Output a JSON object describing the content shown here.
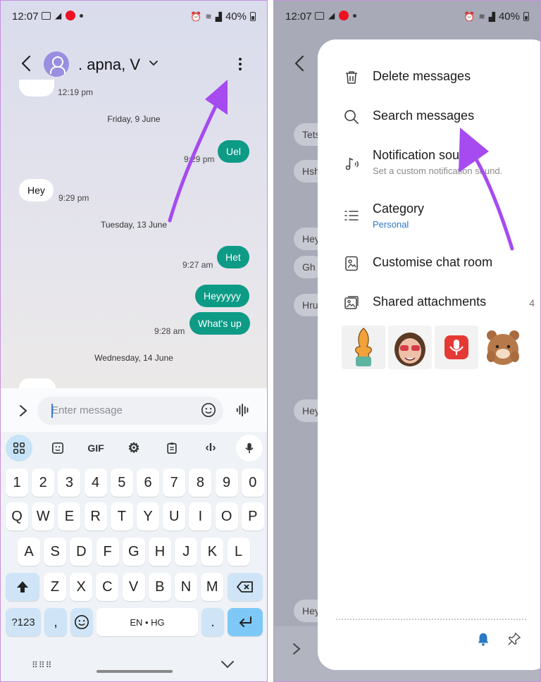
{
  "status": {
    "time": "12:07",
    "battery": "40%"
  },
  "left": {
    "contact_name": ". apna, V",
    "messages": [
      {
        "kind": "ts",
        "text": "12:19 pm"
      },
      {
        "kind": "day",
        "text": "Friday, 9 June"
      },
      {
        "kind": "out",
        "text": "Uel"
      },
      {
        "kind": "ts",
        "text": "9:29 pm"
      },
      {
        "kind": "in",
        "text": "Hey"
      },
      {
        "kind": "ts",
        "text": "9:29 pm"
      },
      {
        "kind": "day",
        "text": "Tuesday, 13 June"
      },
      {
        "kind": "out",
        "text": "Het"
      },
      {
        "kind": "ts",
        "text": "9:27 am"
      },
      {
        "kind": "out",
        "text": "Heyyyyy"
      },
      {
        "kind": "out",
        "text": "What's up"
      },
      {
        "kind": "ts",
        "text": "9:28 am"
      },
      {
        "kind": "day",
        "text": "Wednesday, 14 June"
      }
    ],
    "composer_placeholder": "Enter message",
    "keyboard": {
      "tools": [
        "GIF"
      ],
      "row_numbers": [
        "1",
        "2",
        "3",
        "4",
        "5",
        "6",
        "7",
        "8",
        "9",
        "0"
      ],
      "row_q": [
        "Q",
        "W",
        "E",
        "R",
        "T",
        "Y",
        "U",
        "I",
        "O",
        "P"
      ],
      "row_a": [
        "A",
        "S",
        "D",
        "F",
        "G",
        "H",
        "J",
        "K",
        "L"
      ],
      "row_z": [
        "Z",
        "X",
        "C",
        "V",
        "B",
        "N",
        "M"
      ],
      "symbols_key": "?123",
      "comma_key": ",",
      "space_key": "EN • HG",
      "period_key": "."
    }
  },
  "right": {
    "background_snippets": [
      "Tets",
      "Hsh",
      "Hey",
      "Gh",
      "Hru",
      "Hey",
      "Hey"
    ],
    "menu": [
      {
        "label": "Delete messages",
        "icon": "trash-icon"
      },
      {
        "label": "Search messages",
        "icon": "search-icon"
      },
      {
        "label": "Notification sound",
        "sub": "Set a custom notification sound.",
        "icon": "music-note-icon"
      },
      {
        "label": "Category",
        "sub": "Personal",
        "icon": "list-icon"
      },
      {
        "label": "Customise chat room",
        "icon": "image-frame-icon"
      },
      {
        "label": "Shared attachments",
        "count": "4",
        "icon": "gallery-icon"
      }
    ],
    "attachments": [
      "crossed-fingers-sticker",
      "sunglasses-face-sticker",
      "voice-recording-icon",
      "bear-sticker"
    ]
  },
  "colors": {
    "sent_bubble": "#0d9b86",
    "accent_blue": "#2a79c4",
    "arrow": "#a64bf0",
    "border": "#c78fe0"
  }
}
